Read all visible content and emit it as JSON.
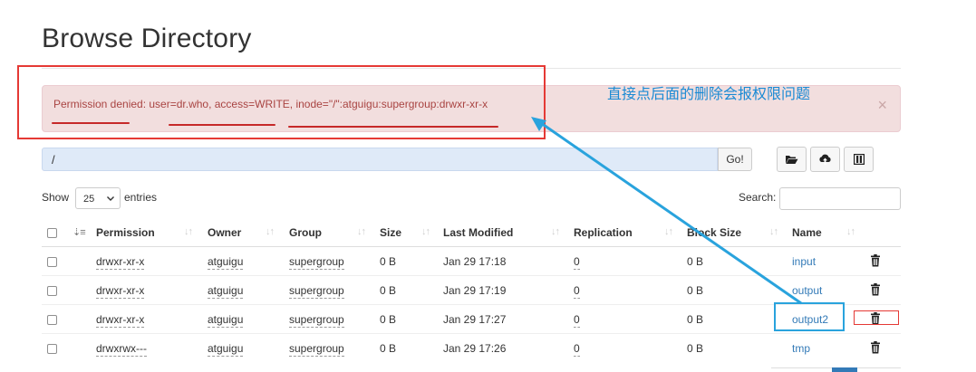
{
  "page": {
    "title": "Browse Directory"
  },
  "alert": {
    "message": "Permission denied: user=dr.who, access=WRITE, inode=\"/\":atguigu:supergroup:drwxr-xr-x",
    "close_glyph": "×"
  },
  "annotation": {
    "text": "直接点后面的删除会报权限问题",
    "color": "#1a8ad4"
  },
  "path_bar": {
    "value": "/",
    "go_label": "Go!"
  },
  "toolbar": {
    "buttons": [
      "folder-open-icon",
      "upload-icon",
      "columns-icon"
    ]
  },
  "table_controls": {
    "show_label": "Show",
    "page_size": "25",
    "entries_label": "entries",
    "search_label": "Search:",
    "search_value": ""
  },
  "table": {
    "columns": [
      "Permission",
      "Owner",
      "Group",
      "Size",
      "Last Modified",
      "Replication",
      "Block Size",
      "Name"
    ],
    "rows": [
      {
        "permission": "drwxr-xr-x",
        "owner": "atguigu",
        "group": "supergroup",
        "size": "0 B",
        "last_modified": "Jan 29 17:18",
        "replication": "0",
        "block_size": "0 B",
        "name": "input"
      },
      {
        "permission": "drwxr-xr-x",
        "owner": "atguigu",
        "group": "supergroup",
        "size": "0 B",
        "last_modified": "Jan 29 17:19",
        "replication": "0",
        "block_size": "0 B",
        "name": "output"
      },
      {
        "permission": "drwxr-xr-x",
        "owner": "atguigu",
        "group": "supergroup",
        "size": "0 B",
        "last_modified": "Jan 29 17:27",
        "replication": "0",
        "block_size": "0 B",
        "name": "output2"
      },
      {
        "permission": "drwxrwx---",
        "owner": "atguigu",
        "group": "supergroup",
        "size": "0 B",
        "last_modified": "Jan 29 17:26",
        "replication": "0",
        "block_size": "0 B",
        "name": "tmp"
      }
    ]
  },
  "colors": {
    "alert_bg": "#f2dede",
    "alert_text": "#a94442",
    "link": "#337ab7",
    "markup_red": "#e53935",
    "markup_blue": "#29a3dd"
  }
}
